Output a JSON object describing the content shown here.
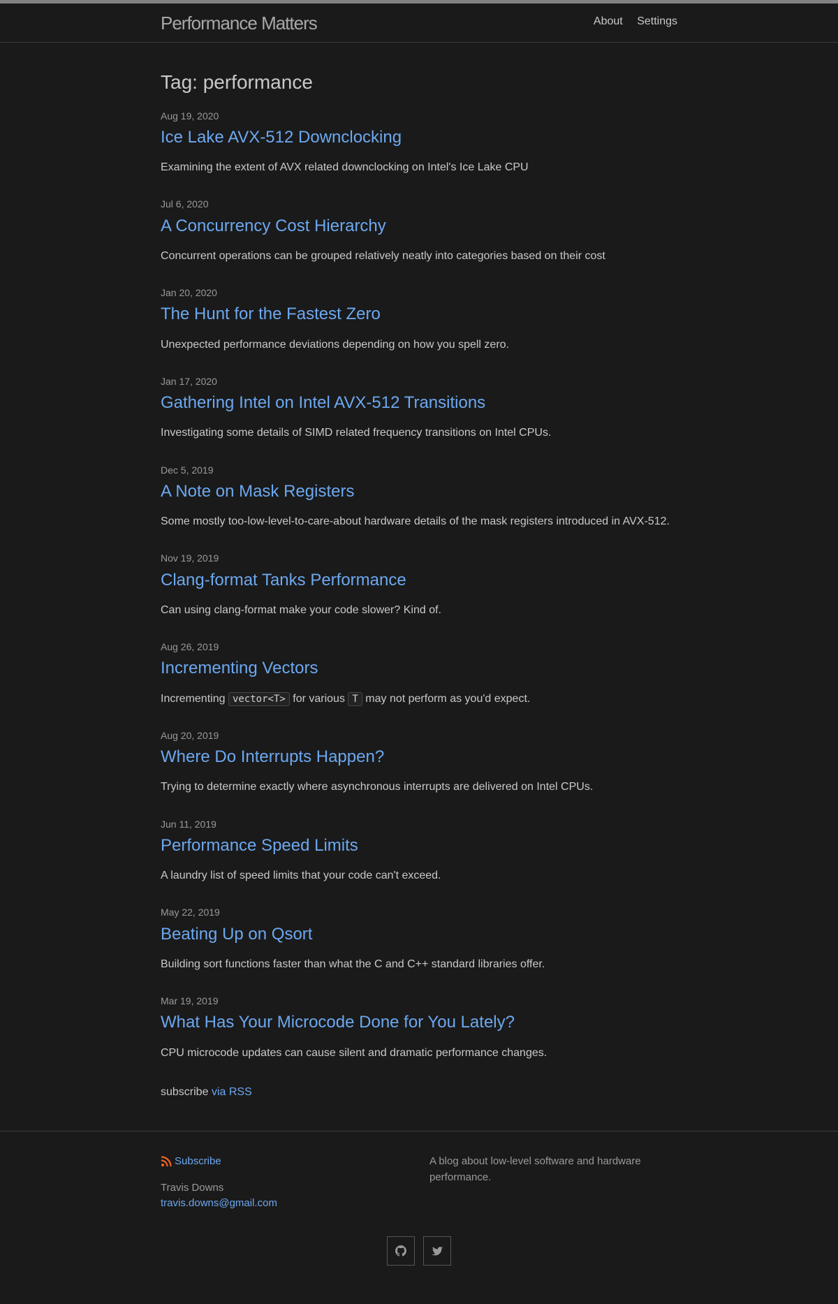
{
  "header": {
    "title": "Performance Matters",
    "nav": [
      "About",
      "Settings"
    ]
  },
  "page": {
    "heading": "Tag: performance"
  },
  "posts": [
    {
      "date": "Aug 19, 2020",
      "title": "Ice Lake AVX-512 Downclocking",
      "excerpt": "Examining the extent of AVX related downclocking on Intel's Ice Lake CPU"
    },
    {
      "date": "Jul 6, 2020",
      "title": "A Concurrency Cost Hierarchy",
      "excerpt": "Concurrent operations can be grouped relatively neatly into categories based on their cost"
    },
    {
      "date": "Jan 20, 2020",
      "title": "The Hunt for the Fastest Zero",
      "excerpt": "Unexpected performance deviations depending on how you spell zero."
    },
    {
      "date": "Jan 17, 2020",
      "title": "Gathering Intel on Intel AVX-512 Transitions",
      "excerpt": "Investigating some details of SIMD related frequency transitions on Intel CPUs."
    },
    {
      "date": "Dec 5, 2019",
      "title": "A Note on Mask Registers",
      "excerpt": "Some mostly too-low-level-to-care-about hardware details of the mask registers introduced in AVX-512."
    },
    {
      "date": "Nov 19, 2019",
      "title": "Clang-format Tanks Performance",
      "excerpt": "Can using clang-format make your code slower? Kind of."
    },
    {
      "date": "Aug 26, 2019",
      "title": "Incrementing Vectors",
      "excerpt_parts": [
        "Incrementing ",
        "vector<T>",
        " for various ",
        "T",
        " may not perform as you'd expect."
      ]
    },
    {
      "date": "Aug 20, 2019",
      "title": "Where Do Interrupts Happen?",
      "excerpt": "Trying to determine exactly where asynchronous interrupts are delivered on Intel CPUs."
    },
    {
      "date": "Jun 11, 2019",
      "title": "Performance Speed Limits",
      "excerpt": "A laundry list of speed limits that your code can't exceed."
    },
    {
      "date": "May 22, 2019",
      "title": "Beating Up on Qsort",
      "excerpt": "Building sort functions faster than what the C and C++ standard libraries offer."
    },
    {
      "date": "Mar 19, 2019",
      "title": "What Has Your Microcode Done for You Lately?",
      "excerpt": "CPU microcode updates can cause silent and dramatic performance changes."
    }
  ],
  "rss": {
    "prefix": "subscribe",
    "link": "via RSS"
  },
  "footer": {
    "subscribe": "Subscribe",
    "name": "Travis Downs",
    "email": "travis.downs@gmail.com",
    "description": "A blog about low-level software and hardware performance.",
    "social": [
      "github-icon",
      "twitter-icon"
    ]
  },
  "colors": {
    "background": "#1a1a1a",
    "link": "#6ca8f0",
    "rss": "#f26522"
  }
}
